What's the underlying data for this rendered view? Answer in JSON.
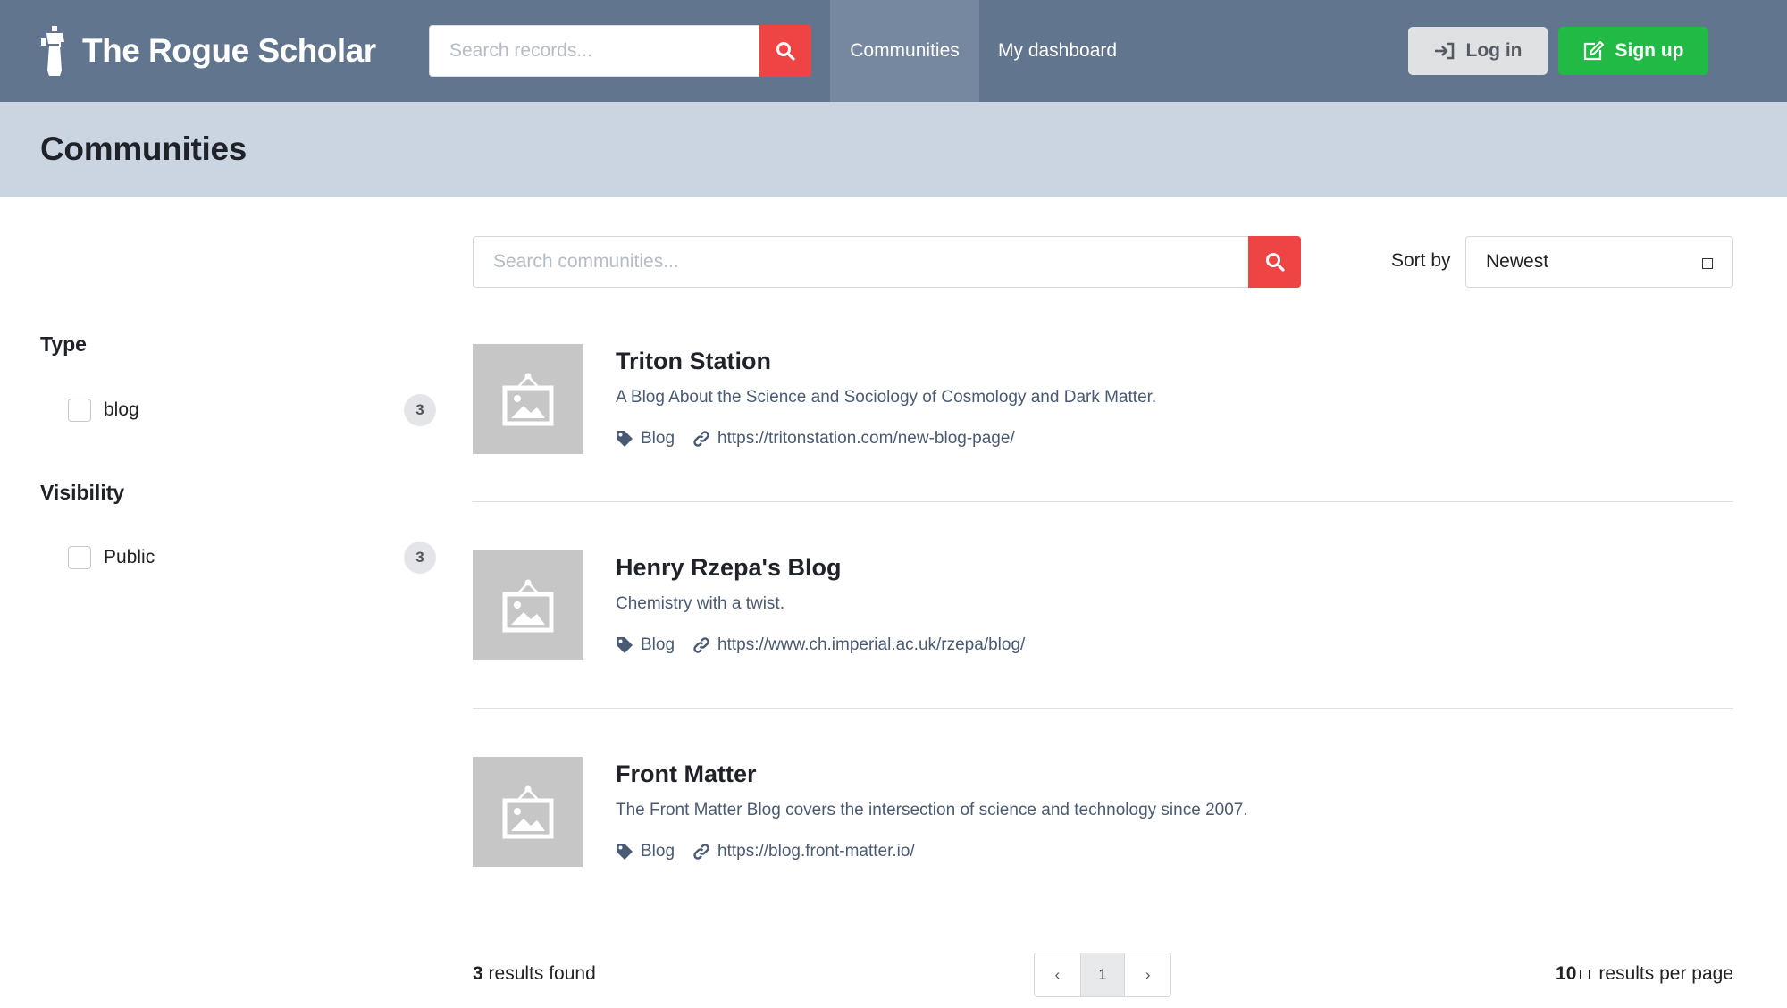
{
  "header": {
    "brand": "The Rogue Scholar",
    "search_placeholder": "Search records...",
    "nav": [
      "Communities",
      "My dashboard"
    ],
    "login_label": "Log in",
    "signup_label": "Sign up"
  },
  "page": {
    "title": "Communities"
  },
  "facets": {
    "type": {
      "title": "Type",
      "options": [
        {
          "label": "blog",
          "count": "3"
        }
      ]
    },
    "visibility": {
      "title": "Visibility",
      "options": [
        {
          "label": "Public",
          "count": "3"
        }
      ]
    }
  },
  "search": {
    "placeholder": "Search communities...",
    "sort_label": "Sort by",
    "sort_value": "Newest"
  },
  "results": [
    {
      "title": "Triton Station",
      "description": "A Blog About the Science and Sociology of Cosmology and Dark Matter.",
      "type": "Blog",
      "url": "https://tritonstation.com/new-blog-page/"
    },
    {
      "title": "Henry Rzepa's Blog",
      "description": "Chemistry with a twist.",
      "type": "Blog",
      "url": "https://www.ch.imperial.ac.uk/rzepa/blog/"
    },
    {
      "title": "Front Matter",
      "description": "The Front Matter Blog covers the intersection of science and technology since 2007.",
      "type": "Blog",
      "url": "https://blog.front-matter.io/"
    }
  ],
  "footer": {
    "results_count": "3",
    "results_label": "results found",
    "pagination": {
      "prev": "‹",
      "current": "1",
      "next": "›"
    },
    "per_page_value": "10",
    "per_page_label": "results per page"
  },
  "colors": {
    "header_bg": "#62758e",
    "title_band_bg": "#cbd5e1",
    "search_button": "#ef4444",
    "signup_button": "#21ba45",
    "login_button": "#e0e1e2"
  }
}
